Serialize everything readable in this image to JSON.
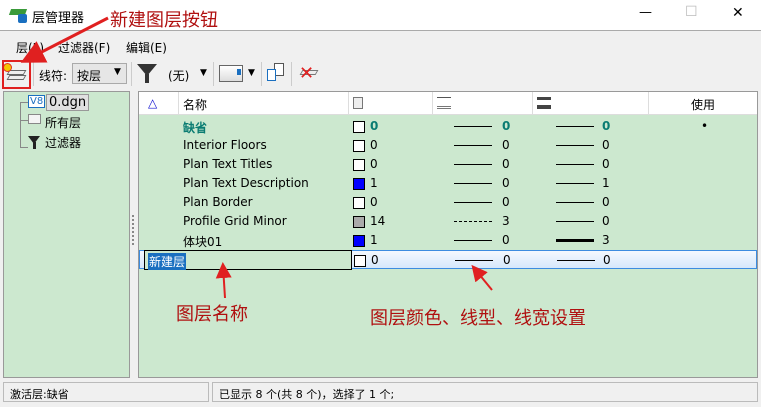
{
  "window": {
    "title": "层管理器",
    "minimize": "—",
    "maximize": "☐",
    "close": "✕"
  },
  "menu": [
    "层(L)",
    "过滤器(F)",
    "编辑(E)"
  ],
  "toolbar": {
    "symbology_label": "线符:",
    "symbology_value": "按层",
    "filter_value": "(无)"
  },
  "tree": {
    "file": "0.dgn",
    "file_badge": "V8",
    "all_layers": "所有层",
    "filters": "过滤器"
  },
  "table": {
    "headers": {
      "sort": "△",
      "name": "名称",
      "use": "使用"
    },
    "rows": [
      {
        "name": "缺省",
        "color": "#ffffff",
        "color_num": "0",
        "style": "0",
        "weight": "0",
        "used": "•",
        "active": true
      },
      {
        "name": "Interior Floors",
        "color": "#ffffff",
        "color_num": "0",
        "style": "0",
        "weight": "0",
        "used": ""
      },
      {
        "name": "Plan Text Titles",
        "color": "#ffffff",
        "color_num": "0",
        "style": "0",
        "weight": "0",
        "used": ""
      },
      {
        "name": "Plan Text Description",
        "color": "#0000ff",
        "color_num": "1",
        "style": "0",
        "weight": "1",
        "used": ""
      },
      {
        "name": "Plan Border",
        "color": "#ffffff",
        "color_num": "0",
        "style": "0",
        "weight": "0",
        "used": ""
      },
      {
        "name": "Profile Grid Minor",
        "color": "#aaaaaa",
        "color_num": "14",
        "style": "3",
        "weight": "0",
        "used": ""
      },
      {
        "name": "体块01",
        "color": "#0000ff",
        "color_num": "1",
        "style": "0",
        "weight": "3",
        "used": ""
      },
      {
        "name": "新建层",
        "color": "#ffffff",
        "color_num": "0",
        "style": "0",
        "weight": "0",
        "used": "",
        "editing": true
      }
    ]
  },
  "status": {
    "active_layer": "激活层:缺省",
    "summary": "已显示 8 个(共 8 个)，选择了 1 个;"
  },
  "annotations": {
    "new_layer_button": "新建图层按钮",
    "layer_name": "图层名称",
    "layer_props": "图层颜色、线型、线宽设置"
  }
}
